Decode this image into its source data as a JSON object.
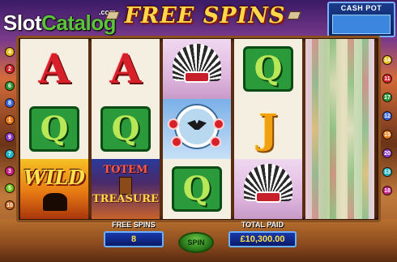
{
  "logo": {
    "part1": "Slot",
    "part2": "Catalog",
    "suffix": ".com"
  },
  "title": "FREE SPINS",
  "cash_pot": {
    "label": "CASH POT",
    "value": ""
  },
  "paylines_left": [
    "4",
    "2",
    "6",
    "8",
    "1",
    "9",
    "7",
    "3",
    "5",
    "10"
  ],
  "paylines_right": [
    "14",
    "11",
    "17",
    "12",
    "15",
    "20",
    "13",
    "18"
  ],
  "reels": [
    [
      "A",
      "Q",
      "WILD"
    ],
    [
      "A",
      "Q",
      "TOTEM TREASURE"
    ],
    [
      "headdress",
      "dreamcatcher",
      "Q"
    ],
    [
      "Q",
      "J",
      "headdress"
    ]
  ],
  "symbols": {
    "wild_label": "WILD",
    "totem_line1": "TOTEM",
    "totem_line2": "TREASURE"
  },
  "bottom": {
    "free_spins_label": "FREE SPINS",
    "free_spins_value": "8",
    "spin_label": "SPIN",
    "total_paid_label": "TOTAL PAID",
    "total_paid_value": "£10,300.00"
  },
  "colors": {
    "card_A": "#d8202a",
    "card_Q": "#2a9a3a",
    "card_J": "#f0a010",
    "panel_blue": "#1a3aaa",
    "title_gold": "#ffd84a"
  }
}
